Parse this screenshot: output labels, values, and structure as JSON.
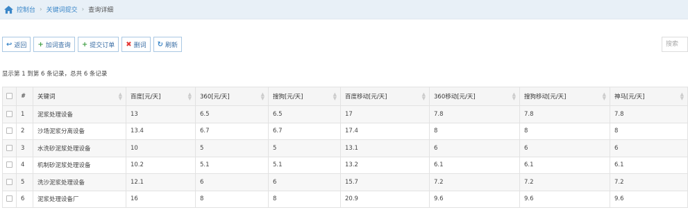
{
  "breadcrumb": {
    "items": [
      "控制台",
      "关键词提交",
      "查询详细"
    ]
  },
  "toolbar": {
    "back": "返回",
    "add_query": "加词查询",
    "submit_order": "提交订单",
    "delete": "删词",
    "refresh": "刷新"
  },
  "search": {
    "placeholder": "搜索"
  },
  "summary": "显示第 1 到第 6 条记录，总共 6 条记录",
  "table": {
    "headers": [
      "#",
      "关键词",
      "百度[元/天]",
      "360[元/天]",
      "搜狗[元/天]",
      "百度移动[元/天]",
      "360移动[元/天]",
      "搜狗移动[元/天]",
      "神马[元/天]"
    ],
    "rows": [
      [
        "1",
        "泥浆处理设备",
        "13",
        "6.5",
        "6.5",
        "17",
        "7.8",
        "7.8",
        "7.8"
      ],
      [
        "2",
        "沙场泥浆分离设备",
        "13.4",
        "6.7",
        "6.7",
        "17.4",
        "8",
        "8",
        "8"
      ],
      [
        "3",
        "水洗砂泥浆处理设备",
        "10",
        "5",
        "5",
        "13.1",
        "6",
        "6",
        "6"
      ],
      [
        "4",
        "机制砂泥浆处理设备",
        "10.2",
        "5.1",
        "5.1",
        "13.2",
        "6.1",
        "6.1",
        "6.1"
      ],
      [
        "5",
        "洗沙泥浆处理设备",
        "12.1",
        "6",
        "6",
        "15.7",
        "7.2",
        "7.2",
        "7.2"
      ],
      [
        "6",
        "泥浆处理设备厂",
        "16",
        "8",
        "8",
        "20.9",
        "9.6",
        "9.6",
        "9.6"
      ]
    ]
  }
}
